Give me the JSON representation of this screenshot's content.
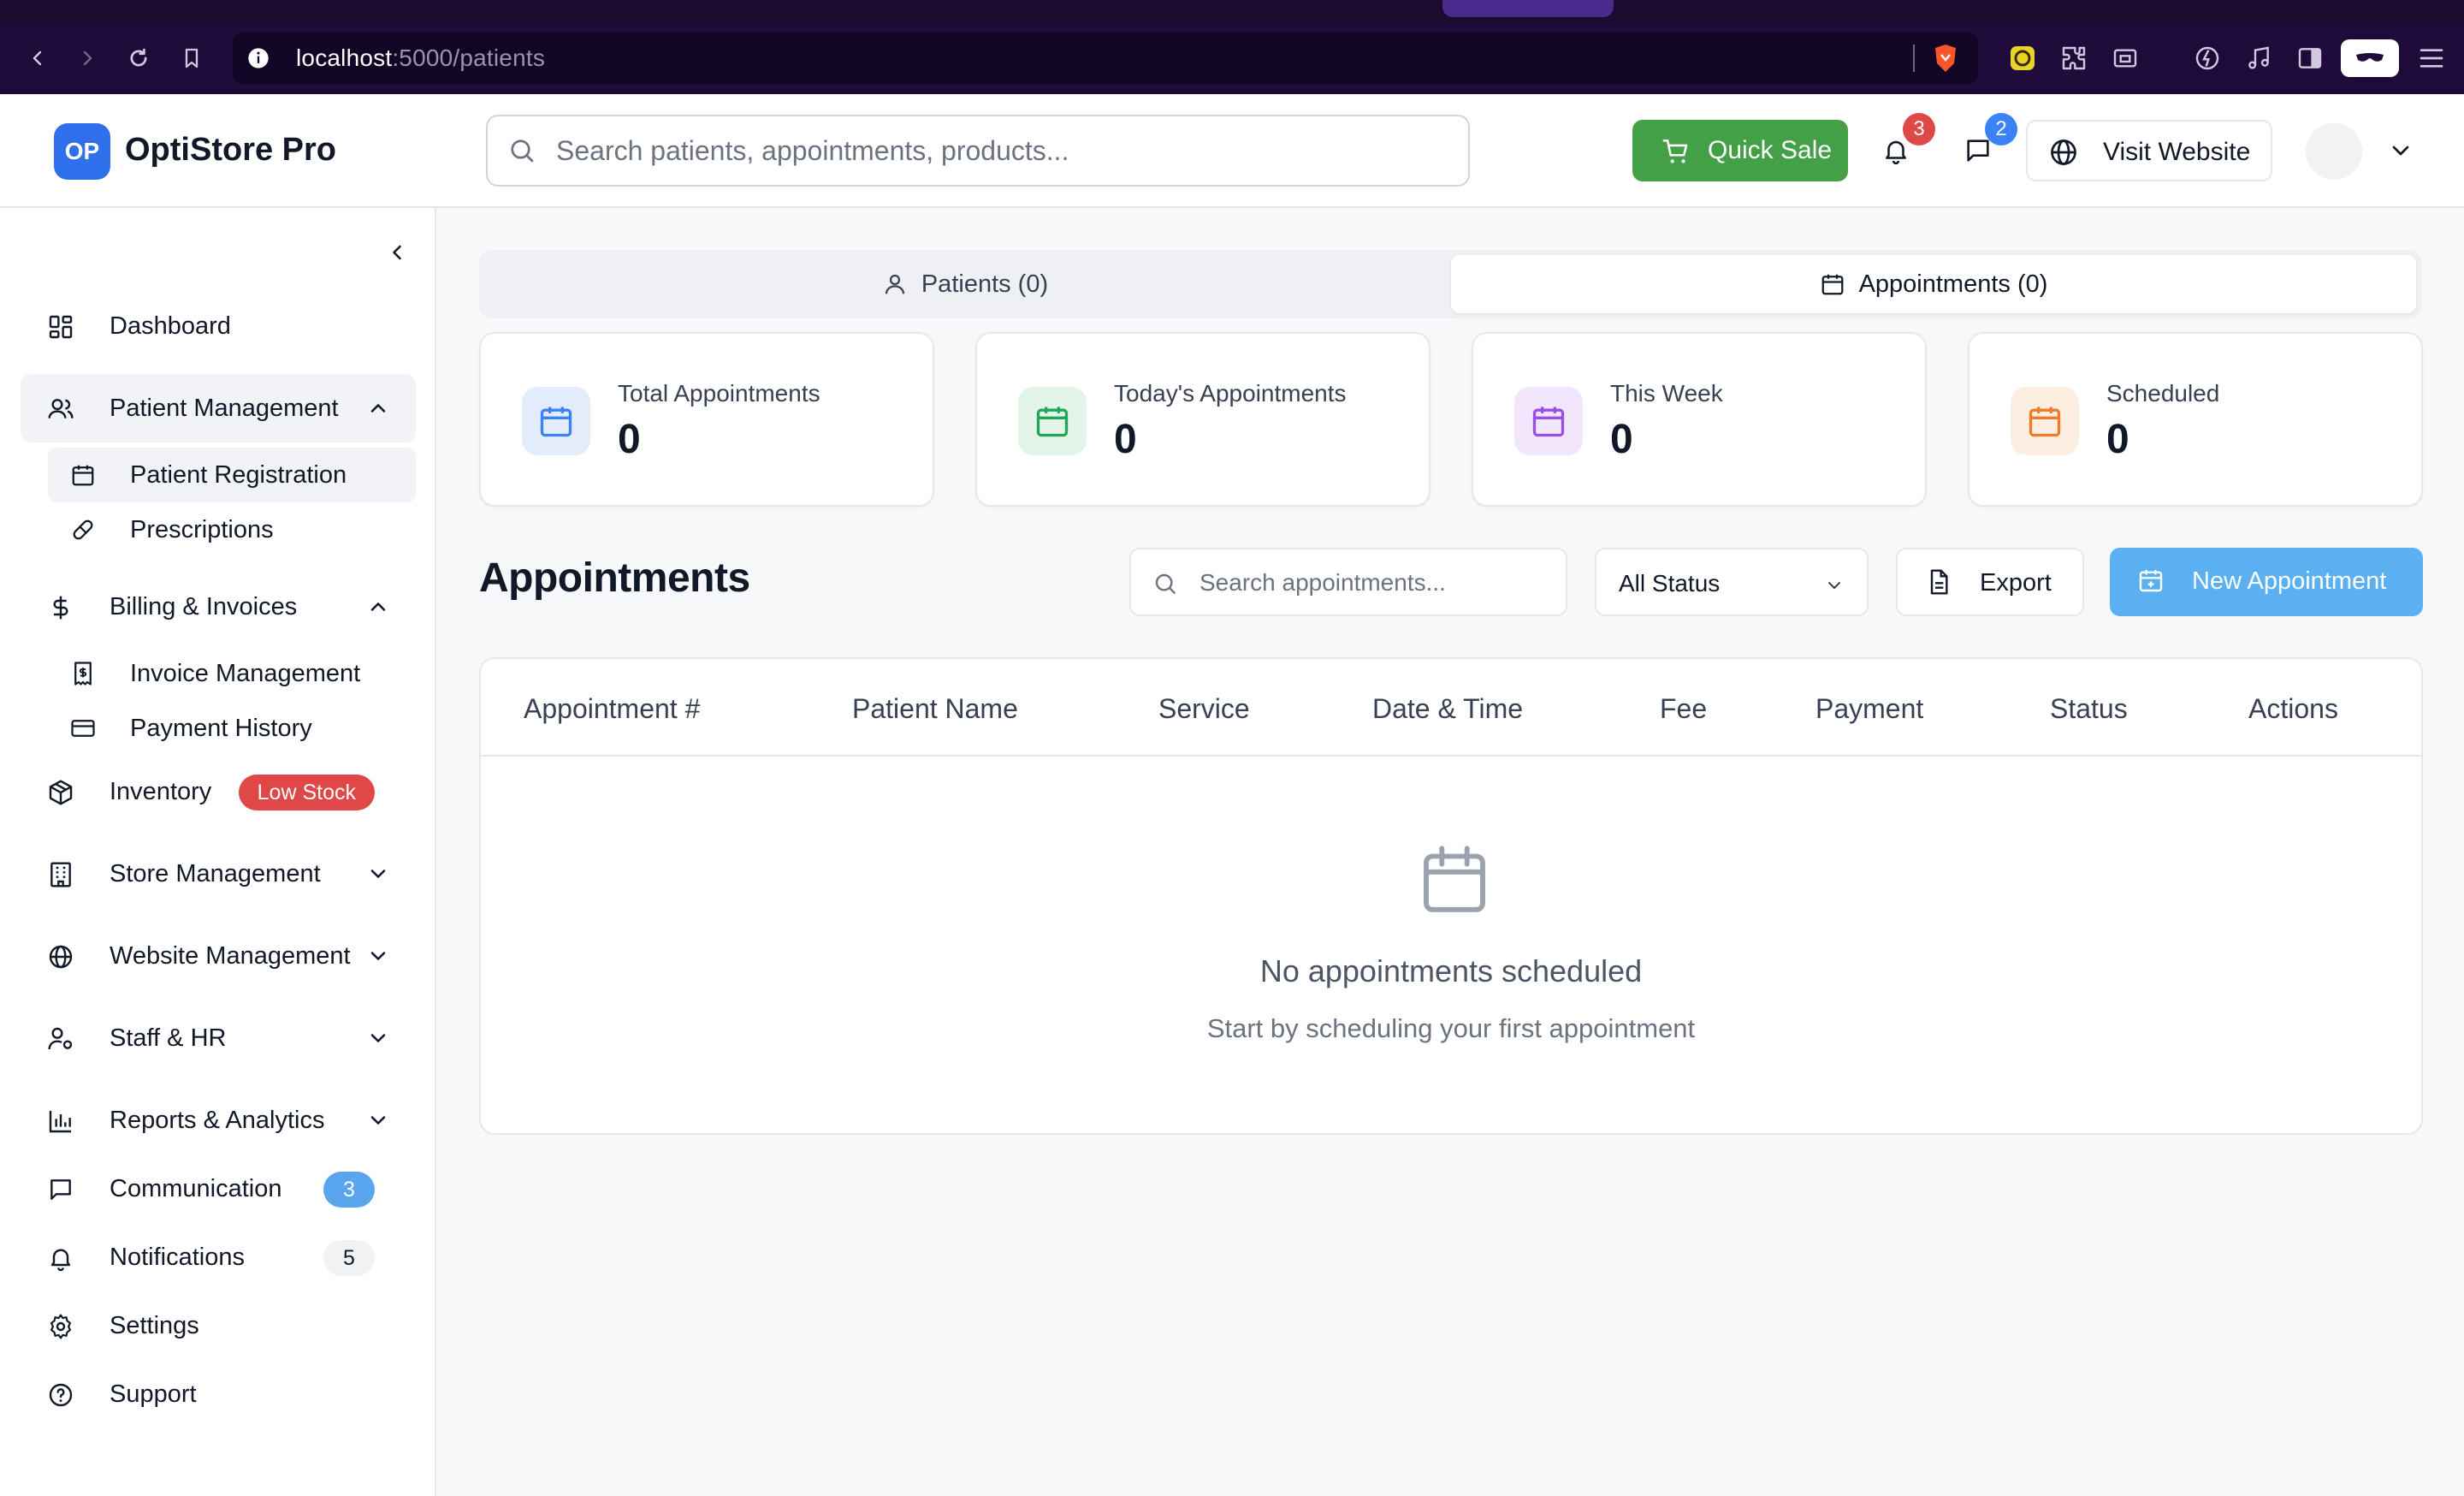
{
  "browser": {
    "url_host": "localhost",
    "url_path": ":5000/patients"
  },
  "header": {
    "logo_initials": "OP",
    "app_name": "OptiStore Pro",
    "search_placeholder": "Search patients, appointments, products...",
    "quick_sale_label": "Quick Sale",
    "notifications_count": "3",
    "messages_count": "2",
    "visit_website_label": "Visit Website"
  },
  "sidebar": {
    "dashboard": "Dashboard",
    "patient_management": "Patient Management",
    "patient_registration": "Patient Registration",
    "prescriptions": "Prescriptions",
    "billing_invoices": "Billing & Invoices",
    "invoice_management": "Invoice Management",
    "payment_history": "Payment History",
    "inventory": "Inventory",
    "inventory_badge": "Low Stock",
    "store_management": "Store Management",
    "website_management": "Website Management",
    "staff_hr": "Staff & HR",
    "reports_analytics": "Reports & Analytics",
    "communication": "Communication",
    "communication_badge": "3",
    "notifications": "Notifications",
    "notifications_badge": "5",
    "settings": "Settings",
    "support": "Support"
  },
  "tabs": {
    "patients": "Patients (0)",
    "appointments": "Appointments (0)"
  },
  "stats": [
    {
      "label": "Total Appointments",
      "value": "0",
      "color": "#3b82f6",
      "bg": "#e3ecfb"
    },
    {
      "label": "Today's Appointments",
      "value": "0",
      "color": "#22a55a",
      "bg": "#e2f5e8"
    },
    {
      "label": "This Week",
      "value": "0",
      "color": "#9b4fe0",
      "bg": "#f1e6fb"
    },
    {
      "label": "Scheduled",
      "value": "0",
      "color": "#ef7a2a",
      "bg": "#fdeee2"
    }
  ],
  "appointments": {
    "title": "Appointments",
    "search_placeholder": "Search appointments...",
    "status_filter": "All Status",
    "export_label": "Export",
    "new_label": "New Appointment",
    "columns": [
      "Appointment #",
      "Patient Name",
      "Service",
      "Date & Time",
      "Fee",
      "Payment",
      "Status",
      "Actions"
    ],
    "empty_title": "No appointments scheduled",
    "empty_subtitle": "Start by scheduling your first appointment"
  }
}
